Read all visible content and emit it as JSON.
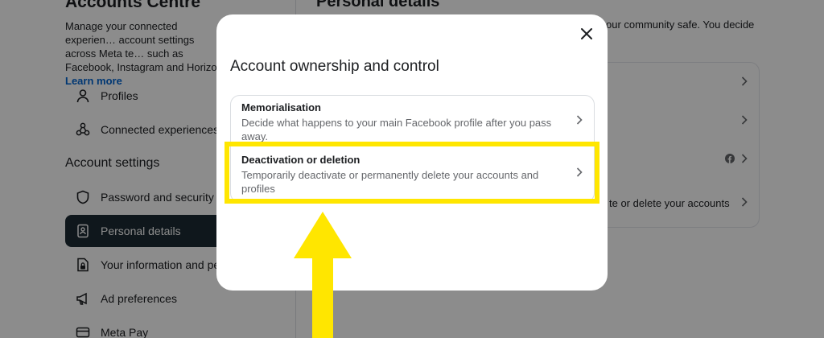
{
  "background": {
    "accounts_centre": {
      "title": "Accounts Centre",
      "description": "Manage your connected experien… account settings across Meta te… such as Facebook, Instagram and Horizon.",
      "learn_more": "Learn more"
    },
    "nav": {
      "profiles": "Profiles",
      "connected": "Connected experiences",
      "section_title": "Account settings",
      "password": "Password and security",
      "personal": "Personal details",
      "your_info": "Your information and per",
      "ad_prefs": "Ad preferences",
      "meta_pay": "Meta Pay"
    },
    "personal_details": {
      "title": "Personal details",
      "description": "our community safe. You decide",
      "row_text": "te or delete your accounts"
    }
  },
  "modal": {
    "title": "Account ownership and control",
    "options": [
      {
        "title": "Memorialisation",
        "description": "Decide what happens to your main Facebook profile after you pass away."
      },
      {
        "title": "Deactivation or deletion",
        "description": "Temporarily deactivate or permanently delete your accounts and profiles"
      }
    ]
  },
  "colors": {
    "highlight": "#ffe600",
    "overlay": "rgba(0,0,0,0.45)",
    "active_nav": "#1c2b33",
    "link": "#0064d1"
  }
}
